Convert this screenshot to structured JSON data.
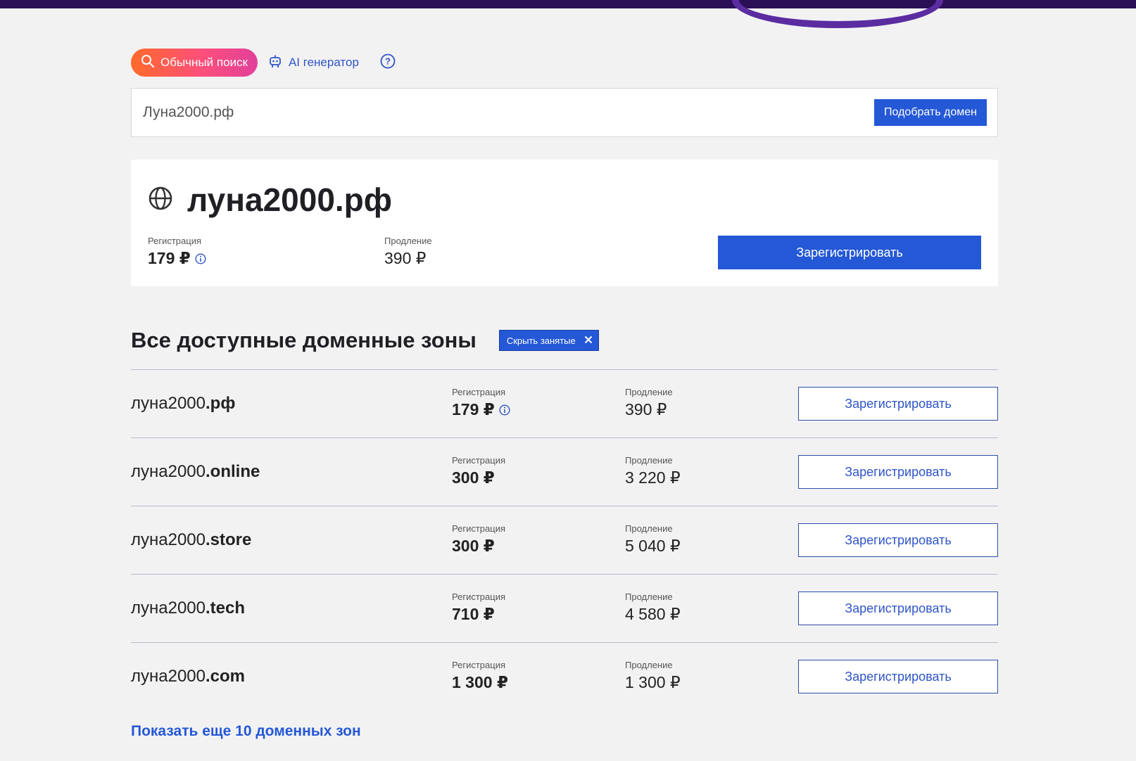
{
  "colors": {
    "accent": "#2458d6",
    "pill_gradient_start": "#ff6a2a",
    "pill_gradient_end": "#e0409a",
    "topbar": "#2a0f57",
    "background": "#f2f2f3"
  },
  "modes": {
    "regular_search_label": "Обычный поиск",
    "ai_generator_label": "AI генератор",
    "regular_icon": "search-icon",
    "ai_icon": "robot-icon",
    "help_icon": "question-circle-icon"
  },
  "search": {
    "value": "Луна2000.рф",
    "button_label": "Подобрать домен"
  },
  "featured": {
    "icon": "globe-icon",
    "domain": "луна2000.рф",
    "registration_label": "Регистрация",
    "registration_price": "179 ₽",
    "renewal_label": "Продление",
    "renewal_price": "390 ₽",
    "register_button": "Зарегистрировать"
  },
  "zones": {
    "title": "Все доступные доменные зоны",
    "hide_taken_label": "Скрыть занятые",
    "rows": [
      {
        "name": "луна2000",
        "tld": ".рф",
        "reg_label": "Регистрация",
        "reg_price": "179 ₽",
        "info": true,
        "renew_label": "Продление",
        "renew_price": "390 ₽",
        "button": "Зарегистрировать"
      },
      {
        "name": "луна2000",
        "tld": ".online",
        "reg_label": "Регистрация",
        "reg_price": "300 ₽",
        "info": false,
        "renew_label": "Продление",
        "renew_price": "3 220 ₽",
        "button": "Зарегистрировать"
      },
      {
        "name": "луна2000",
        "tld": ".store",
        "reg_label": "Регистрация",
        "reg_price": "300 ₽",
        "info": false,
        "renew_label": "Продление",
        "renew_price": "5 040 ₽",
        "button": "Зарегистрировать"
      },
      {
        "name": "луна2000",
        "tld": ".tech",
        "reg_label": "Регистрация",
        "reg_price": "710 ₽",
        "info": false,
        "renew_label": "Продление",
        "renew_price": "4 580 ₽",
        "button": "Зарегистрировать"
      },
      {
        "name": "луна2000",
        "tld": ".com",
        "reg_label": "Регистрация",
        "reg_price": "1 300 ₽",
        "info": false,
        "renew_label": "Продление",
        "renew_price": "1 300 ₽",
        "button": "Зарегистрировать"
      }
    ],
    "show_more_label": "Показать еще 10 доменных зон"
  }
}
